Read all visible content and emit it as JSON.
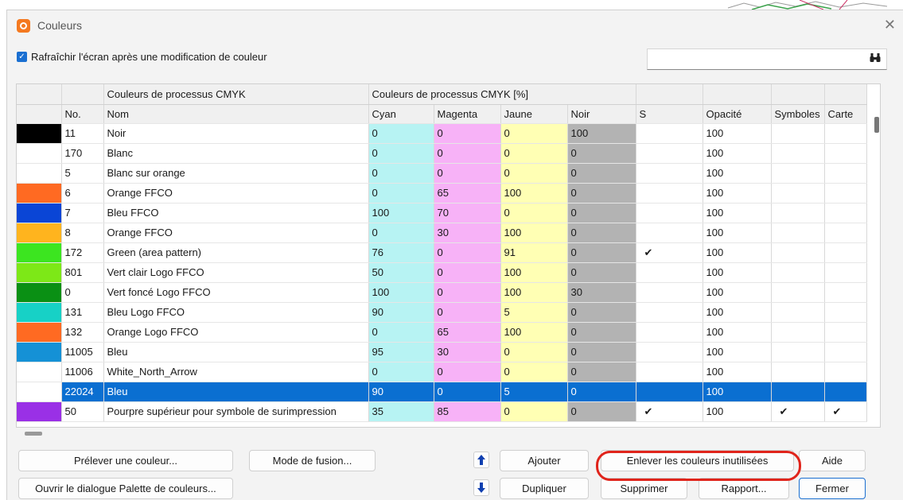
{
  "window": {
    "title": "Couleurs"
  },
  "options": {
    "refresh_label": "Rafraîchir l'écran après une modification de couleur",
    "refresh_checked": true
  },
  "search": {
    "value": "",
    "placeholder": ""
  },
  "table": {
    "group_headers": {
      "processus": "Couleurs de processus CMYK",
      "processus_pct": "Couleurs de processus CMYK [%]"
    },
    "columns": [
      "No.",
      "Nom",
      "Cyan",
      "Magenta",
      "Jaune",
      "Noir",
      "S",
      "Opacité",
      "Symboles",
      "Carte"
    ],
    "rows": [
      {
        "swatch": "#000000",
        "no": "11",
        "nom": "Noir",
        "c": "0",
        "m": "0",
        "j": "0",
        "n": "100",
        "s": "",
        "op": "100",
        "sym": "",
        "carte": ""
      },
      {
        "swatch": "#ffffff",
        "no": "170",
        "nom": "Blanc",
        "c": "0",
        "m": "0",
        "j": "0",
        "n": "0",
        "s": "",
        "op": "100",
        "sym": "",
        "carte": ""
      },
      {
        "swatch": "#ffffff",
        "no": "5",
        "nom": "Blanc sur orange",
        "c": "0",
        "m": "0",
        "j": "0",
        "n": "0",
        "s": "",
        "op": "100",
        "sym": "",
        "carte": ""
      },
      {
        "swatch": "#ff6a22",
        "no": "6",
        "nom": "Orange FFCO",
        "c": "0",
        "m": "65",
        "j": "100",
        "n": "0",
        "s": "",
        "op": "100",
        "sym": "",
        "carte": ""
      },
      {
        "swatch": "#0a45d6",
        "no": "7",
        "nom": "Bleu FFCO",
        "c": "100",
        "m": "70",
        "j": "0",
        "n": "0",
        "s": "",
        "op": "100",
        "sym": "",
        "carte": ""
      },
      {
        "swatch": "#ffb41e",
        "no": "8",
        "nom": "Orange FFCO",
        "c": "0",
        "m": "30",
        "j": "100",
        "n": "0",
        "s": "",
        "op": "100",
        "sym": "",
        "carte": ""
      },
      {
        "swatch": "#3ce520",
        "no": "172",
        "nom": "Green (area pattern)",
        "c": "76",
        "m": "0",
        "j": "91",
        "n": "0",
        "s": "✔",
        "op": "100",
        "sym": "",
        "carte": ""
      },
      {
        "swatch": "#7de817",
        "no": "801",
        "nom": "Vert clair Logo FFCO",
        "c": "50",
        "m": "0",
        "j": "100",
        "n": "0",
        "s": "",
        "op": "100",
        "sym": "",
        "carte": ""
      },
      {
        "swatch": "#0a9014",
        "no": "0",
        "nom": "Vert foncé Logo FFCO",
        "c": "100",
        "m": "0",
        "j": "100",
        "n": "30",
        "s": "",
        "op": "100",
        "sym": "",
        "carte": ""
      },
      {
        "swatch": "#17d1c6",
        "no": "131",
        "nom": "Bleu Logo FFCO",
        "c": "90",
        "m": "0",
        "j": "5",
        "n": "0",
        "s": "",
        "op": "100",
        "sym": "",
        "carte": ""
      },
      {
        "swatch": "#ff6a22",
        "no": "132",
        "nom": "Orange Logo FFCO",
        "c": "0",
        "m": "65",
        "j": "100",
        "n": "0",
        "s": "",
        "op": "100",
        "sym": "",
        "carte": ""
      },
      {
        "swatch": "#1591d6",
        "no": "11005",
        "nom": "Bleu",
        "c": "95",
        "m": "30",
        "j": "0",
        "n": "0",
        "s": "",
        "op": "100",
        "sym": "",
        "carte": ""
      },
      {
        "swatch": "#ffffff",
        "no": "11006",
        "nom": "White_North_Arrow",
        "c": "0",
        "m": "0",
        "j": "0",
        "n": "0",
        "s": "",
        "op": "100",
        "sym": "",
        "carte": ""
      },
      {
        "swatch": "#17d1c6",
        "no": "22024",
        "nom": "Bleu",
        "c": "90",
        "m": "0",
        "j": "5",
        "n": "0",
        "s": "",
        "op": "100",
        "sym": "",
        "carte": "",
        "selected": true
      },
      {
        "swatch": "#9a30e6",
        "no": "50",
        "nom": "Pourpre supérieur pour symbole de surimpression",
        "c": "35",
        "m": "85",
        "j": "0",
        "n": "0",
        "s": "✔",
        "op": "100",
        "sym": "✔",
        "carte": "✔"
      }
    ]
  },
  "buttons": {
    "prelever": "Prélever une couleur...",
    "mode_fusion": "Mode de fusion...",
    "palette": "Ouvrir le dialogue Palette de couleurs...",
    "ajouter": "Ajouter",
    "dupliquer": "Dupliquer",
    "enlever": "Enlever les couleurs inutilisées",
    "supprimer": "Supprimer",
    "rapport": "Rapport...",
    "aide": "Aide",
    "fermer": "Fermer"
  },
  "colors": {
    "accent": "#1a6fd1",
    "selection": "#0a6fd1",
    "highlight_ring": "#e0241b",
    "cyan_col": "#b7f3f3",
    "magenta_col": "#f7b2f7",
    "jaune_col": "#ffffb4",
    "noir_col": "#b3b3b3"
  },
  "icons": {
    "app": "app-logo-icon",
    "search": "binoculars-icon",
    "up": "arrow-up-icon",
    "down": "arrow-down-icon",
    "close": "close-icon"
  }
}
